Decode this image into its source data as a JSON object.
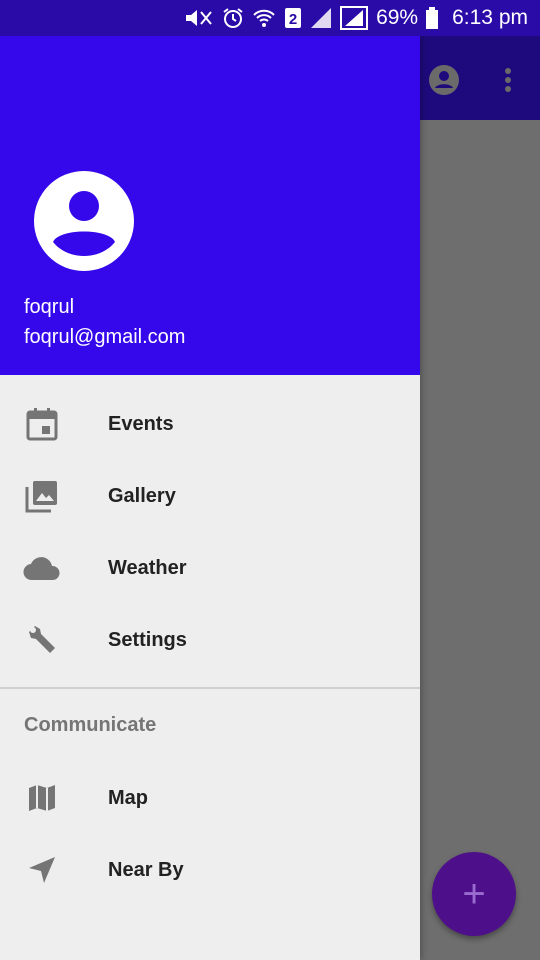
{
  "status_bar": {
    "battery_percent": "69%",
    "time": "6:13 pm",
    "sim_slot": "2",
    "icons": [
      "mute-icon",
      "alarm-icon",
      "wifi-icon",
      "sim-2-icon",
      "signal-icon",
      "signal-icon",
      "battery-icon"
    ]
  },
  "app_bar": {
    "actions": [
      "account-circle-icon",
      "more-vert-icon"
    ]
  },
  "drawer": {
    "header": {
      "avatar_icon": "account-circle-icon",
      "name": "foqrul",
      "email": "foqrul@gmail.com",
      "background": "#3508ec"
    },
    "items": [
      {
        "label": "Events",
        "icon": "event-icon"
      },
      {
        "label": "Gallery",
        "icon": "photo-library-icon"
      },
      {
        "label": "Weather",
        "icon": "cloud-icon"
      },
      {
        "label": "Settings",
        "icon": "wrench-icon"
      }
    ],
    "section": {
      "title": "Communicate",
      "items": [
        {
          "label": "Map",
          "icon": "map-icon"
        },
        {
          "label": "Near By",
          "icon": "navigation-icon"
        }
      ]
    }
  },
  "fab": {
    "label": "+",
    "icon": "add-icon",
    "color": "#4e0f8a"
  }
}
